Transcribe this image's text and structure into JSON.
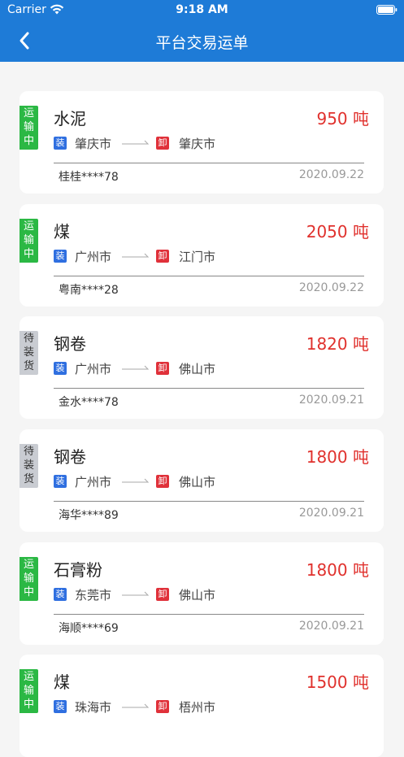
{
  "status_bar": {
    "carrier": "Carrier",
    "time": "9:18 AM"
  },
  "nav": {
    "title": "平台交易运单"
  },
  "load_tag": "装",
  "unload_tag": "卸",
  "orders": [
    {
      "status": [
        "运",
        "输",
        "中"
      ],
      "status_type": "transit",
      "cargo": "水泥",
      "weight": "950 吨",
      "from": "肇庆市",
      "to": "肇庆市",
      "user": "桂桂****78",
      "date": "2020.09.22"
    },
    {
      "status": [
        "运",
        "输",
        "中"
      ],
      "status_type": "transit",
      "cargo": "煤",
      "weight": "2050 吨",
      "from": "广州市",
      "to": "江门市",
      "user": "粤南****28",
      "date": "2020.09.22"
    },
    {
      "status": [
        "待",
        "装",
        "货"
      ],
      "status_type": "waiting",
      "cargo": "钢卷",
      "weight": "1820 吨",
      "from": "广州市",
      "to": "佛山市",
      "user": "金水****78",
      "date": "2020.09.21"
    },
    {
      "status": [
        "待",
        "装",
        "货"
      ],
      "status_type": "waiting",
      "cargo": "钢卷",
      "weight": "1800 吨",
      "from": "广州市",
      "to": "佛山市",
      "user": "海华****89",
      "date": "2020.09.21"
    },
    {
      "status": [
        "运",
        "输",
        "中"
      ],
      "status_type": "transit",
      "cargo": "石膏粉",
      "weight": "1800 吨",
      "from": "东莞市",
      "to": "佛山市",
      "user": "海顺****69",
      "date": "2020.09.21"
    },
    {
      "status": [
        "运",
        "输",
        "中"
      ],
      "status_type": "transit",
      "cargo": "煤",
      "weight": "1500 吨",
      "from": "珠海市",
      "to": "梧州市",
      "user": "",
      "date": ""
    }
  ],
  "colors": {
    "primary": "#1e7bd7",
    "transit": "#2bb844",
    "waiting": "#c9ccd2",
    "weight": "#e0312d",
    "load": "#2f6fe0",
    "unload": "#e0313a"
  }
}
